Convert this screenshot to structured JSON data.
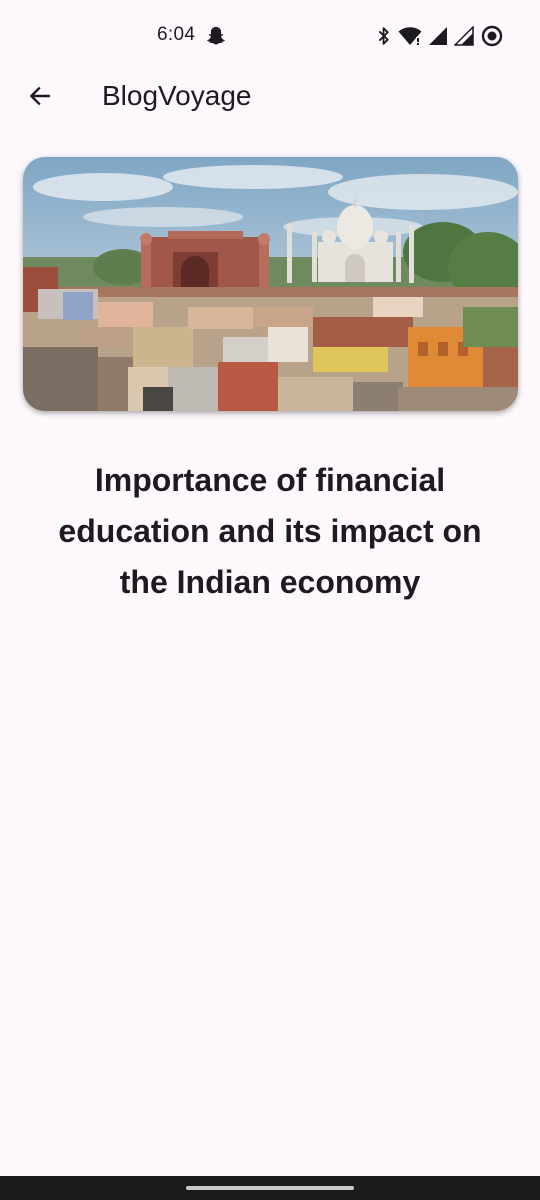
{
  "status_bar": {
    "time": "6:04",
    "icons": [
      "snapchat-icon",
      "bluetooth-icon",
      "wifi-icon",
      "signal-icon",
      "signal-icon",
      "record-icon"
    ]
  },
  "app_bar": {
    "back_icon": "arrow-left-icon",
    "title": "BlogVoyage"
  },
  "article": {
    "image": "taj-mahal-city-skyline",
    "title": "Importance of financial education and its impact on the Indian economy"
  },
  "colors": {
    "background": "#fdf8fc",
    "text": "#1d1b20",
    "nav_bar": "#1b1b1b"
  }
}
